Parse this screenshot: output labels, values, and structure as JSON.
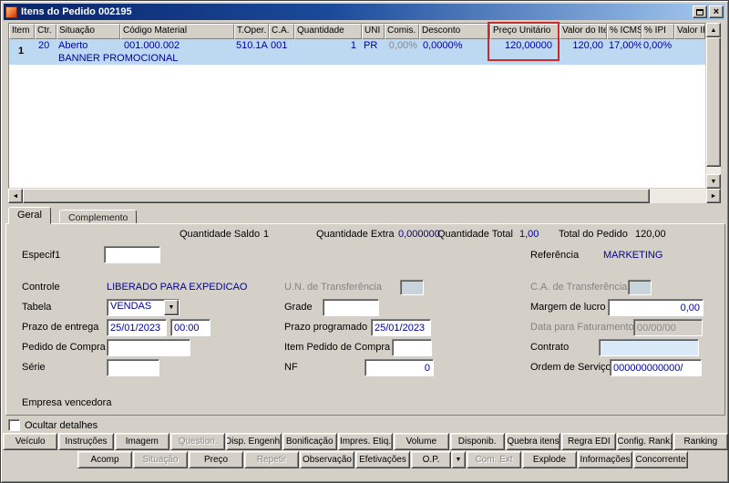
{
  "window": {
    "title": "Itens do Pedido 002195"
  },
  "icons": {
    "close": "×",
    "up_arrow": "▲",
    "down_arrow": "▼",
    "left_arrow": "◄",
    "right_arrow": "►",
    "dropdown": "▼"
  },
  "colors": {
    "titlebar_left": "#0a246a",
    "titlebar_right": "#a6caf0",
    "value_blue": "#000099",
    "selected_row_bg": "#bdd9f2",
    "annotation_red": "#c92a2a",
    "window_bg": "#d4d0c8"
  },
  "grid": {
    "columns": [
      {
        "label": "Item"
      },
      {
        "label": "Ctr."
      },
      {
        "label": "Situação"
      },
      {
        "label": "Código Material"
      },
      {
        "label": "T.Oper."
      },
      {
        "label": "C.A."
      },
      {
        "label": "Quantidade"
      },
      {
        "label": "UNI"
      },
      {
        "label": "Comis."
      },
      {
        "label": "Desconto"
      },
      {
        "label": "Preço Unitário"
      },
      {
        "label": "Valor do Item"
      },
      {
        "label": "% ICMS"
      },
      {
        "label": "% IPI"
      },
      {
        "label": "Valor IPI"
      }
    ],
    "row": {
      "item": "1",
      "ctr": "20",
      "situacao": "Aberto",
      "codigo_material": "001.000.002",
      "t_oper": "510.1A",
      "c_a": "001",
      "quantidade": "1",
      "uni": "PR",
      "comis": "0,00%",
      "desconto": "0,0000%",
      "preco_unitario": "120,00000",
      "valor_item": "120,00",
      "icms": "17,00%",
      "ipi": "0,00%",
      "valor_ipi": "",
      "descricao": "BANNER PROMOCIONAL"
    }
  },
  "tabs": {
    "geral": "Geral",
    "complemento": "Complemento"
  },
  "summary": {
    "quantidade_saldo": {
      "label": "Quantidade Saldo",
      "value": "1"
    },
    "quantidade_extra": {
      "label": "Quantidade Extra",
      "value": "0,000000"
    },
    "quantidade_total": {
      "label": "Quantidade Total",
      "value": "1,00"
    },
    "total_pedido": {
      "label": "Total do Pedido",
      "value": "120,00"
    }
  },
  "form": {
    "especif1": {
      "label": "Especif1",
      "value": ""
    },
    "referencia": {
      "label": "Referência",
      "value": "MARKETING"
    },
    "controle": {
      "label": "Controle",
      "value": "LIBERADO PARA EXPEDICAO"
    },
    "un_transferencia": {
      "label": "U.N. de Transferência"
    },
    "ca_transferencia": {
      "label": "C.A. de Transferência"
    },
    "tabela": {
      "label": "Tabela",
      "value": "VENDAS"
    },
    "grade": {
      "label": "Grade",
      "value": ""
    },
    "margem_lucro": {
      "label": "Margem de lucro",
      "value": "0,00"
    },
    "prazo_entrega": {
      "label": "Prazo de entrega",
      "date": "25/01/2023",
      "time": "00:00"
    },
    "prazo_programado": {
      "label": "Prazo programado",
      "value": "25/01/2023"
    },
    "data_faturamento": {
      "label": "Data para Faturamento",
      "value": "00/00/00"
    },
    "pedido_compra": {
      "label": "Pedido de Compra",
      "value": ""
    },
    "item_pedido_compra": {
      "label": "Item Pedido de Compra",
      "value": ""
    },
    "contrato": {
      "label": "Contrato",
      "value": ""
    },
    "serie": {
      "label": "Série",
      "value": ""
    },
    "nf": {
      "label": "NF",
      "value": "0"
    },
    "ordem_servico": {
      "label": "Ordem de Serviço",
      "value": "000000000000/"
    },
    "empresa_vencedora": "Empresa vencedora"
  },
  "footer": {
    "ocultar_detalhes": "Ocultar detalhes"
  },
  "buttons_row1": [
    {
      "label": "Veículo"
    },
    {
      "label": "Instruções"
    },
    {
      "label": "Imagem"
    },
    {
      "label": "Question."
    },
    {
      "label": "Disp. Engenh."
    },
    {
      "label": "Bonificação"
    },
    {
      "label": "Impres. Etiq."
    },
    {
      "label": "Volume"
    },
    {
      "label": "Disponib."
    },
    {
      "label": "Quebra itens"
    },
    {
      "label": "Regra EDI"
    },
    {
      "label": "Config. Rank."
    },
    {
      "label": "Ranking"
    }
  ],
  "buttons_row2": [
    {
      "label": "Acomp"
    },
    {
      "label": "Situação"
    },
    {
      "label": "Preço"
    },
    {
      "label": "Repetir"
    },
    {
      "label": "Observação"
    },
    {
      "label": "Efetivações"
    },
    {
      "label": "O.P."
    },
    {
      "label": "Com. Ext"
    },
    {
      "label": "Explode"
    },
    {
      "label": "Informações"
    },
    {
      "label": "Concorrente"
    }
  ]
}
